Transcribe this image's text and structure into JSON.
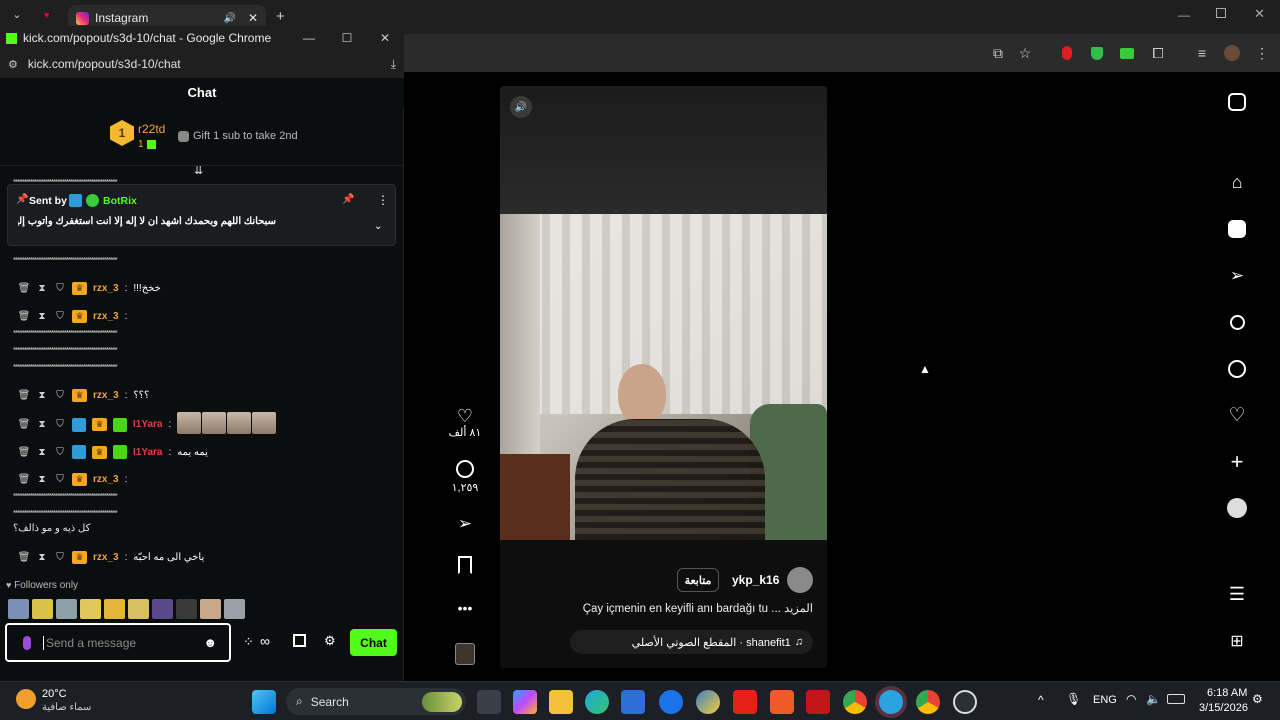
{
  "browser_bg": {
    "tab_title": "Instagram",
    "new_tab_symbol": "+"
  },
  "chat_window": {
    "title": "kick.com/popout/s3d-10/chat - Google Chrome",
    "url": "kick.com/popout/s3d-10/chat",
    "header": "Chat",
    "leader": {
      "rank": "1",
      "username": "r22td",
      "count": "1",
      "gift_text": "Gift 1 sub to take 2nd"
    },
    "pinned": {
      "sent_by_label": "Sent by",
      "sender": "BotRix",
      "text": "سبحانك اللهم وبحمدك أشهد أن لا إله إلا أنت أستغفرك وأتوب إليك"
    },
    "stars_line": "*************************************************",
    "messages": [
      {
        "user": "rzx_3",
        "text": "!!!خخخ"
      },
      {
        "user": "rzx_3",
        "text": ""
      },
      {
        "user": "rzx_3",
        "text": "؟؟؟"
      },
      {
        "user": "I1Yara",
        "text": ""
      },
      {
        "user": "I1Yara",
        "text": "يمه يمه"
      },
      {
        "user": "rzx_3",
        "text": ""
      },
      {
        "user": "rzx_3",
        "text": "ياخي الى مه احبّه"
      }
    ],
    "long_line_text": "كل ذيه و مو ذالف؟",
    "followers_only": "Followers only",
    "input_placeholder": "Send a message",
    "chat_button": "Chat"
  },
  "reel": {
    "likes": "٨١ ألف",
    "comments": "١,٢٥٩",
    "username": "ykp_k16",
    "follow_label": "متابعة",
    "caption": "Çay içmenin en keyifli anı bardağı tu ... المزيد",
    "audio": "المقطع الصوتي الأصلي · shanefit1"
  },
  "taskbar": {
    "weather_temp": "20°C",
    "weather_desc": "سماء صافية",
    "search_label": "Search",
    "language": "ENG",
    "time": "6:18 AM",
    "date": "3/15/2026"
  }
}
